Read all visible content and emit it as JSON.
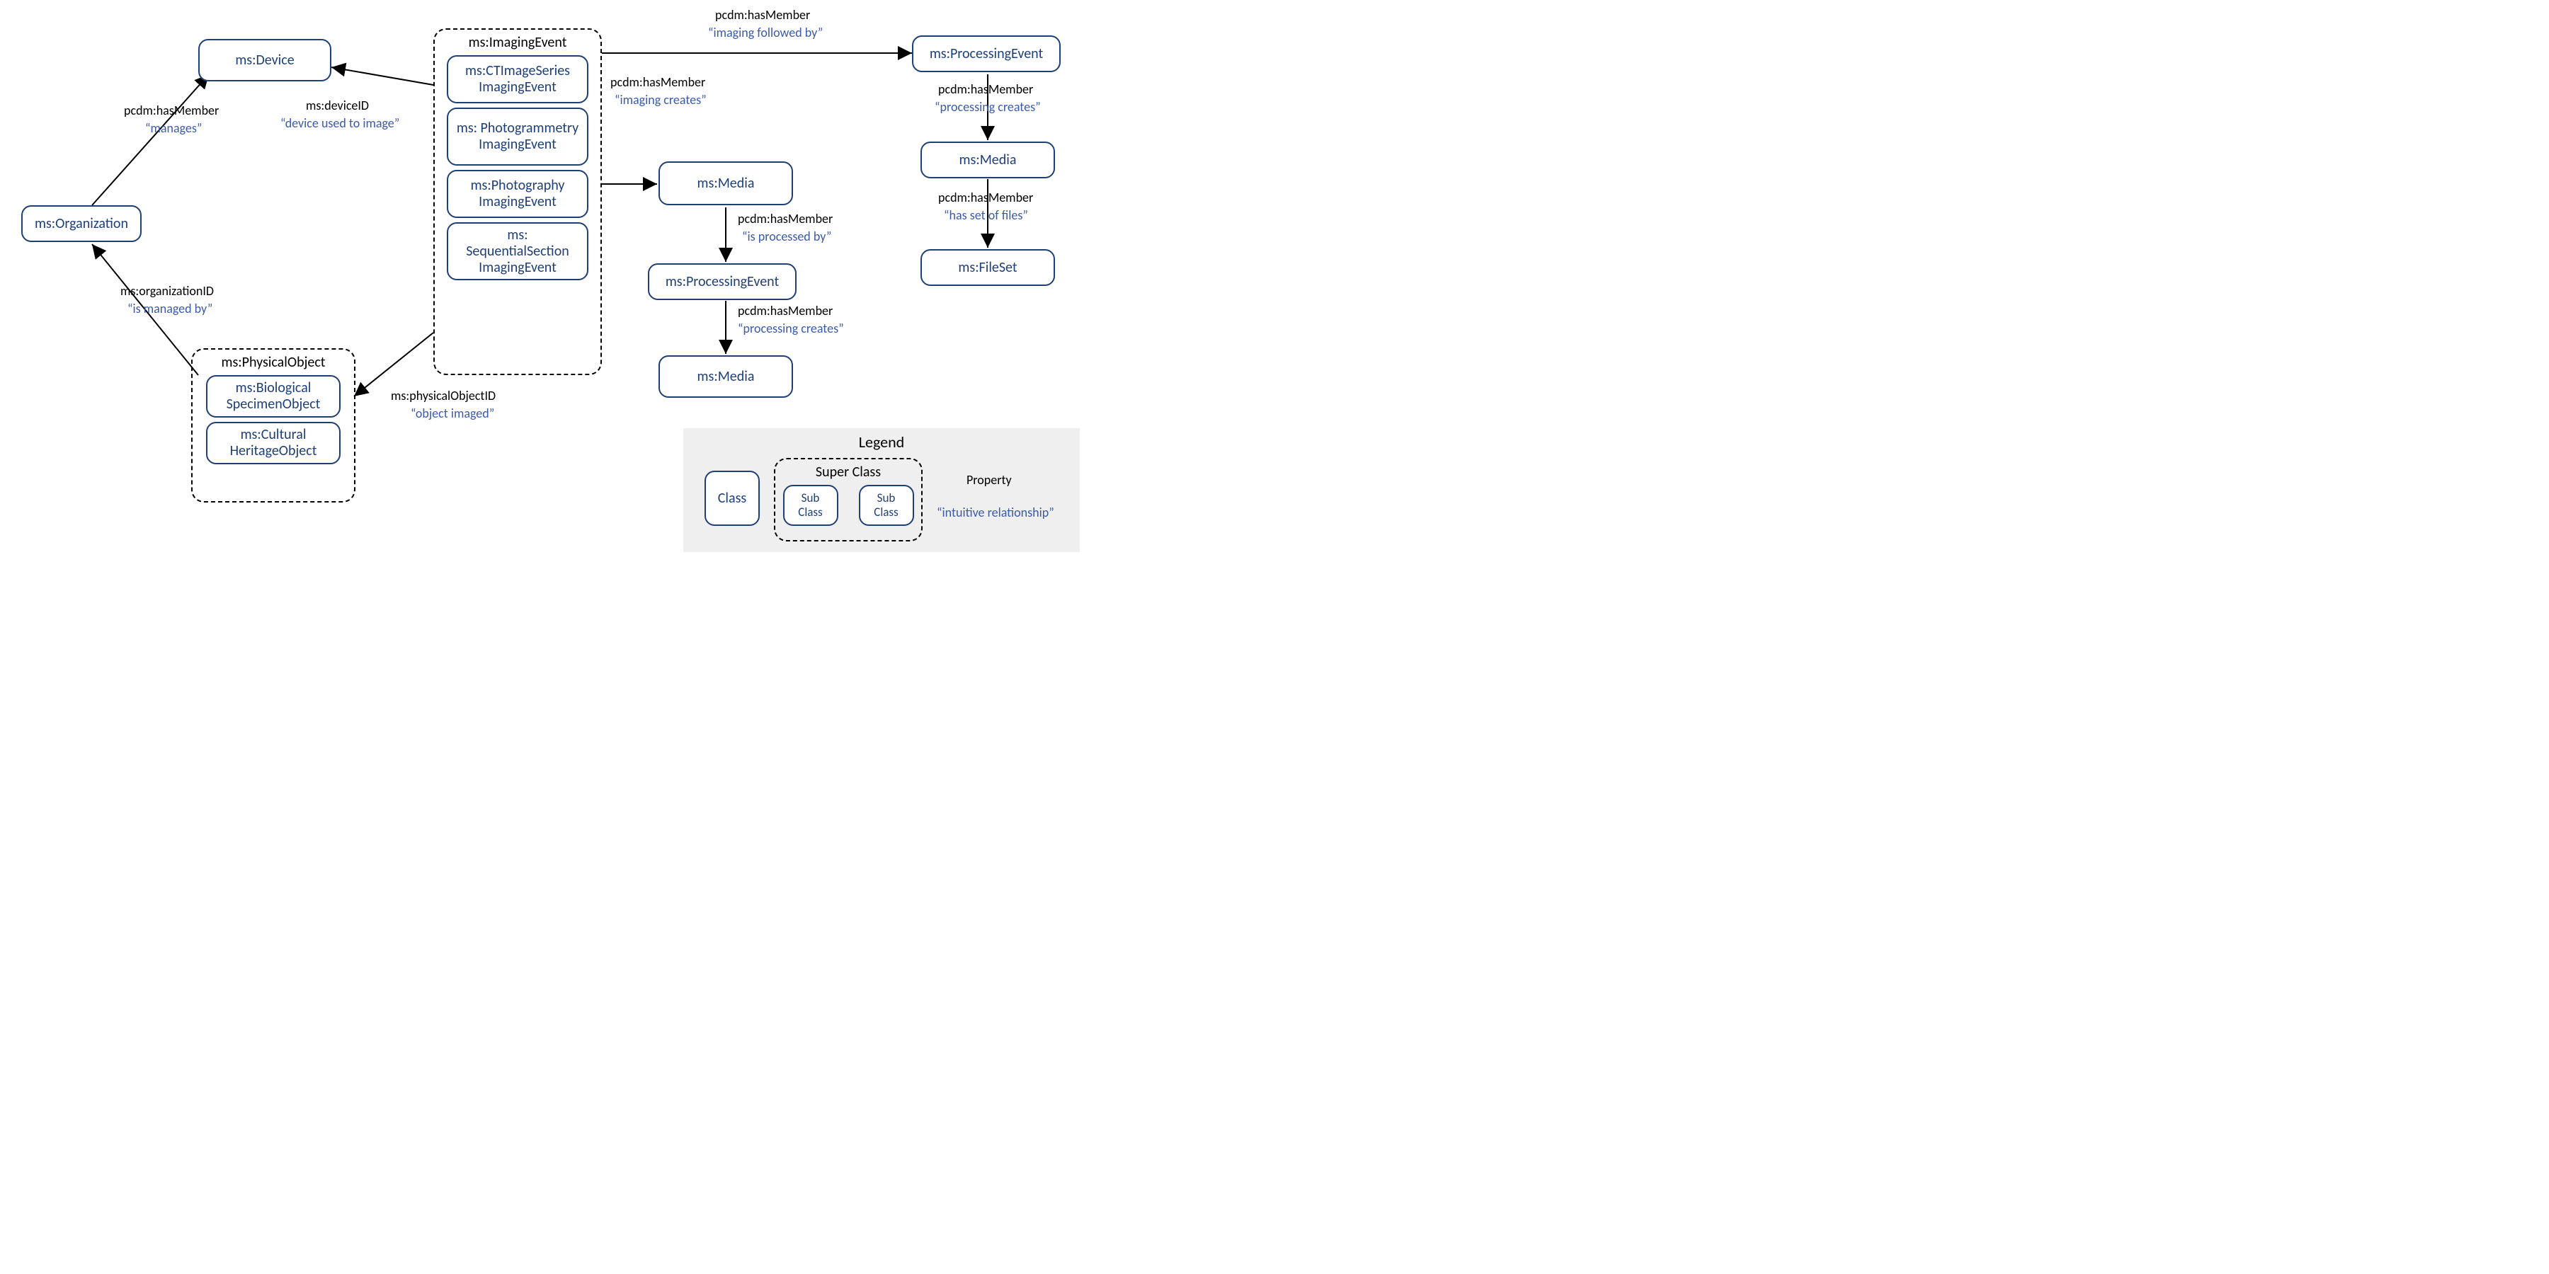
{
  "nodes": {
    "organization": "ms:Organization",
    "device": "ms:Device",
    "physicalObject": {
      "title": "ms:PhysicalObject",
      "subs": [
        "ms:Biological SpecimenObject",
        "ms:Cultural HeritageObject"
      ]
    },
    "imagingEvent": {
      "title": "ms:ImagingEvent",
      "subs": [
        "ms:CTImageSeries ImagingEvent",
        "ms: Photogrammetry ImagingEvent",
        "ms:Photography ImagingEvent",
        "ms: SequentialSection ImagingEvent"
      ]
    },
    "processingEvent": "ms:ProcessingEvent",
    "media1": "ms:Media",
    "processingEvent2": "ms:ProcessingEvent",
    "media2": "ms:Media",
    "media3": "ms:Media",
    "fileSet": "ms:FileSet"
  },
  "edges": {
    "org_device": {
      "prop": "pcdm:hasMember",
      "rel": "“manages”"
    },
    "imaging_device": {
      "prop": "ms:deviceID",
      "rel": "“device used to image”"
    },
    "phys_org": {
      "prop": "ms:organizationID",
      "rel": "“is managed by”"
    },
    "imaging_phys": {
      "prop": "ms:physicalObjectID",
      "rel": "“object imaged”"
    },
    "imaging_proc": {
      "prop": "pcdm:hasMember",
      "rel": "“imaging followed by”"
    },
    "imaging_media": {
      "prop": "pcdm:hasMember",
      "rel": "“imaging creates”"
    },
    "media_proc": {
      "prop": "pcdm:hasMember",
      "rel": "“is processed by”"
    },
    "proc_media2": {
      "prop": "pcdm:hasMember",
      "rel": "“processing creates”"
    },
    "proc_media3": {
      "prop": "pcdm:hasMember",
      "rel": "“processing creates”"
    },
    "media_fileset": {
      "prop": "pcdm:hasMember",
      "rel": "“has set of files”"
    }
  },
  "legend": {
    "title": "Legend",
    "class": "Class",
    "super": "Super Class",
    "sub1": "Sub Class",
    "sub2": "Sub Class",
    "prop": "Property",
    "rel": "“intuitive relationship”"
  }
}
